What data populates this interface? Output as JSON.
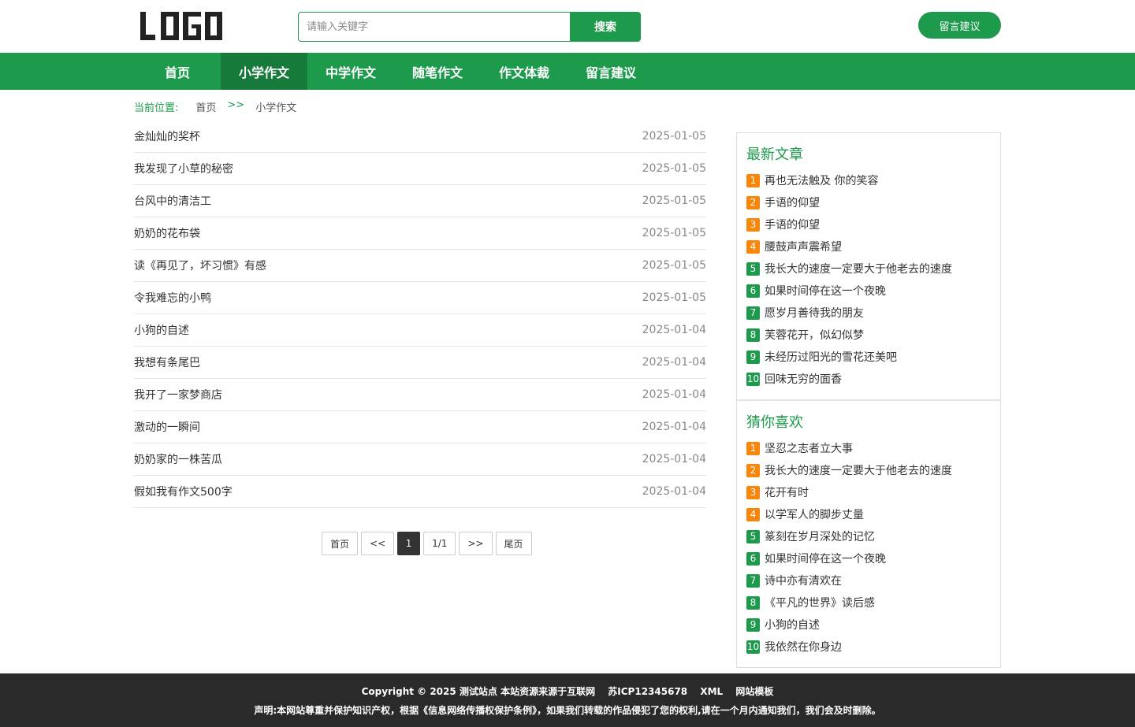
{
  "header": {
    "logo_text": "LOGO",
    "search_placeholder": "请输入关键字",
    "search_button": "搜索",
    "message_button": "留言建议"
  },
  "nav": {
    "items": [
      {
        "label": "首页"
      },
      {
        "label": "小学作文"
      },
      {
        "label": "中学作文"
      },
      {
        "label": "随笔作文"
      },
      {
        "label": "作文体裁"
      },
      {
        "label": "留言建议"
      }
    ],
    "active_index": 1
  },
  "breadcrumb": {
    "label": "当前位置:",
    "home": "首页",
    "separator": ">>",
    "current": "小学作文"
  },
  "articles": [
    {
      "title": "金灿灿的奖杯",
      "date": "2025-01-05"
    },
    {
      "title": "我发现了小草的秘密",
      "date": "2025-01-05"
    },
    {
      "title": "台风中的清洁工",
      "date": "2025-01-05"
    },
    {
      "title": "奶奶的花布袋",
      "date": "2025-01-05"
    },
    {
      "title": "读《再见了，坏习惯》有感",
      "date": "2025-01-05"
    },
    {
      "title": "令我难忘的小鸭",
      "date": "2025-01-05"
    },
    {
      "title": "小狗的自述",
      "date": "2025-01-04"
    },
    {
      "title": "我想有条尾巴",
      "date": "2025-01-04"
    },
    {
      "title": "我开了一家梦商店",
      "date": "2025-01-04"
    },
    {
      "title": "激动的一瞬间",
      "date": "2025-01-04"
    },
    {
      "title": "奶奶家的一株苦瓜",
      "date": "2025-01-04"
    },
    {
      "title": "假如我有作文500字",
      "date": "2025-01-04"
    }
  ],
  "pagination": {
    "first": "首页",
    "prev": "<<",
    "current": "1",
    "info": "1/1",
    "next": ">>",
    "last": "尾页"
  },
  "sidebar": {
    "latest": {
      "title": "最新文章",
      "items": [
        {
          "num": "1",
          "title": "再也无法触及 你的笑容"
        },
        {
          "num": "2",
          "title": "手语的仰望"
        },
        {
          "num": "3",
          "title": "手语的仰望"
        },
        {
          "num": "4",
          "title": "腰鼓声声震希望"
        },
        {
          "num": "5",
          "title": "我长大的速度一定要大于他老去的速度"
        },
        {
          "num": "6",
          "title": "如果时间停在这一个夜晚"
        },
        {
          "num": "7",
          "title": "愿岁月善待我的朋友"
        },
        {
          "num": "8",
          "title": "芙蓉花开，似幻似梦"
        },
        {
          "num": "9",
          "title": "未经历过阳光的雪花还美吧"
        },
        {
          "num": "10",
          "title": "回味无穷的面香"
        }
      ]
    },
    "recommend": {
      "title": "猜你喜欢",
      "items": [
        {
          "num": "1",
          "title": "坚忍之志者立大事"
        },
        {
          "num": "2",
          "title": "我长大的速度一定要大于他老去的速度"
        },
        {
          "num": "3",
          "title": "花开有时"
        },
        {
          "num": "4",
          "title": "以学军人的脚步丈量"
        },
        {
          "num": "5",
          "title": "篆刻在岁月深处的记忆"
        },
        {
          "num": "6",
          "title": "如果时间停在这一个夜晚"
        },
        {
          "num": "7",
          "title": "诗中亦有清欢在"
        },
        {
          "num": "8",
          "title": "《平凡的世界》读后感"
        },
        {
          "num": "9",
          "title": "小狗的自述"
        },
        {
          "num": "10",
          "title": "我依然在你身边"
        }
      ]
    },
    "hot_color": "#f7860b",
    "normal_color": "#1d9a4c"
  },
  "footer": {
    "copyright": "Copyright © 2025 测试站点 本站资源来源于互联网",
    "icp": "苏ICP12345678",
    "xml": "XML",
    "template": "网站模板",
    "statement": "声明:本网站尊重并保护知识产权，根据《信息网络传播权保护条例》，如果我们转载的作品侵犯了您的权利,请在一个月内通知我们，我们会及时删除。"
  },
  "theme": {
    "primary": "#1d9a4c",
    "primary_dark": "#157a3a",
    "footer_bg": "#2a2a2a"
  }
}
